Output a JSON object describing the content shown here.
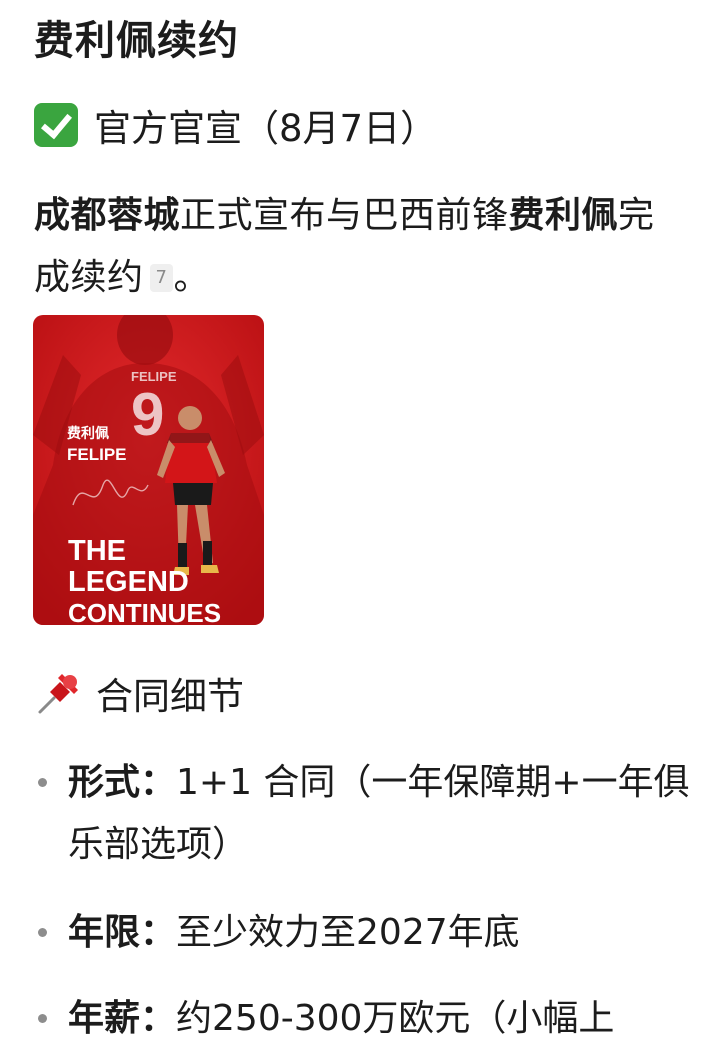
{
  "title": "费利佩续约",
  "announcement": {
    "heading": "官方官宣（8月7日）",
    "para_club": "成都蓉城",
    "para_mid": "正式宣布与巴西前锋",
    "para_player": "费利佩",
    "para_end": "完成续约",
    "citation": "7",
    "para_period": "。"
  },
  "poster": {
    "name_cn": "费利佩",
    "name_en": "FELIPE",
    "jersey_number": "9",
    "tagline_1": "THE",
    "tagline_2": "LEGEND",
    "tagline_3": "CONTINUES",
    "colors": {
      "bg": "#d0181b",
      "dark": "#9a0b0e",
      "gold": "#e8b84a"
    }
  },
  "contract": {
    "heading": "合同细节",
    "items": [
      {
        "key": "形式：",
        "value": "1+1 合同（一年保障期+一年俱乐部选项）"
      },
      {
        "key": "年限：",
        "value": "至少效力至2027年底"
      },
      {
        "key": "年薪：",
        "value": "约250-300万欧元（小幅上"
      }
    ]
  },
  "icons": [
    "check-icon",
    "pushpin-icon"
  ]
}
